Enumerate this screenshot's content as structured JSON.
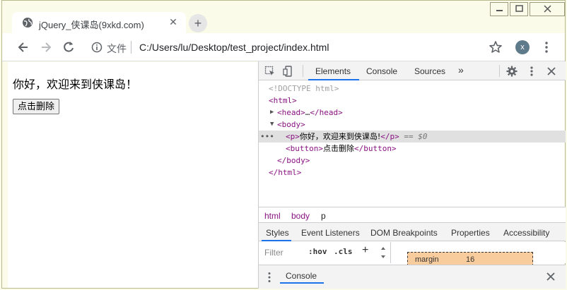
{
  "browser": {
    "tab_title": "jQuery_侠课岛(9xkd.com)",
    "tab_close": "✕",
    "new_tab": "+",
    "address_label": "文件",
    "url": "C:/Users/lu/Desktop/test_project/index.html",
    "profile_initial": "x"
  },
  "page": {
    "paragraph": "你好，欢迎来到侠课岛！",
    "delete_button": "点击删除"
  },
  "devtools": {
    "tabs": [
      "Elements",
      "Console",
      "Sources",
      "»"
    ],
    "active_tab": "Elements",
    "dom": {
      "doctype": "<!DOCTYPE html>",
      "html_open": "<html>",
      "head": "<head>…</head>",
      "head_ellipsis": "…",
      "body_open": "<body>",
      "p_text": "你好，欢迎来到侠课岛!",
      "eq": "== $0",
      "button_text": "点击删除",
      "body_close": "</body>",
      "html_close": "</html>",
      "sel_dots": "•••"
    },
    "breadcrumbs": [
      "html",
      "body",
      "p"
    ],
    "subtabs": [
      "Styles",
      "Event Listeners",
      "DOM Breakpoints",
      "Properties",
      "Accessibility"
    ],
    "filter_placeholder": "Filter",
    "hov": ":hov",
    "cls": ".cls",
    "box_model": {
      "label": "margin",
      "value": "16"
    },
    "drawer_title": "Console"
  },
  "colors": {
    "window_bg": "#fbfbe9",
    "tag": "#881280",
    "accent": "#1a73e8",
    "margin_box": "#f9cc9d"
  }
}
